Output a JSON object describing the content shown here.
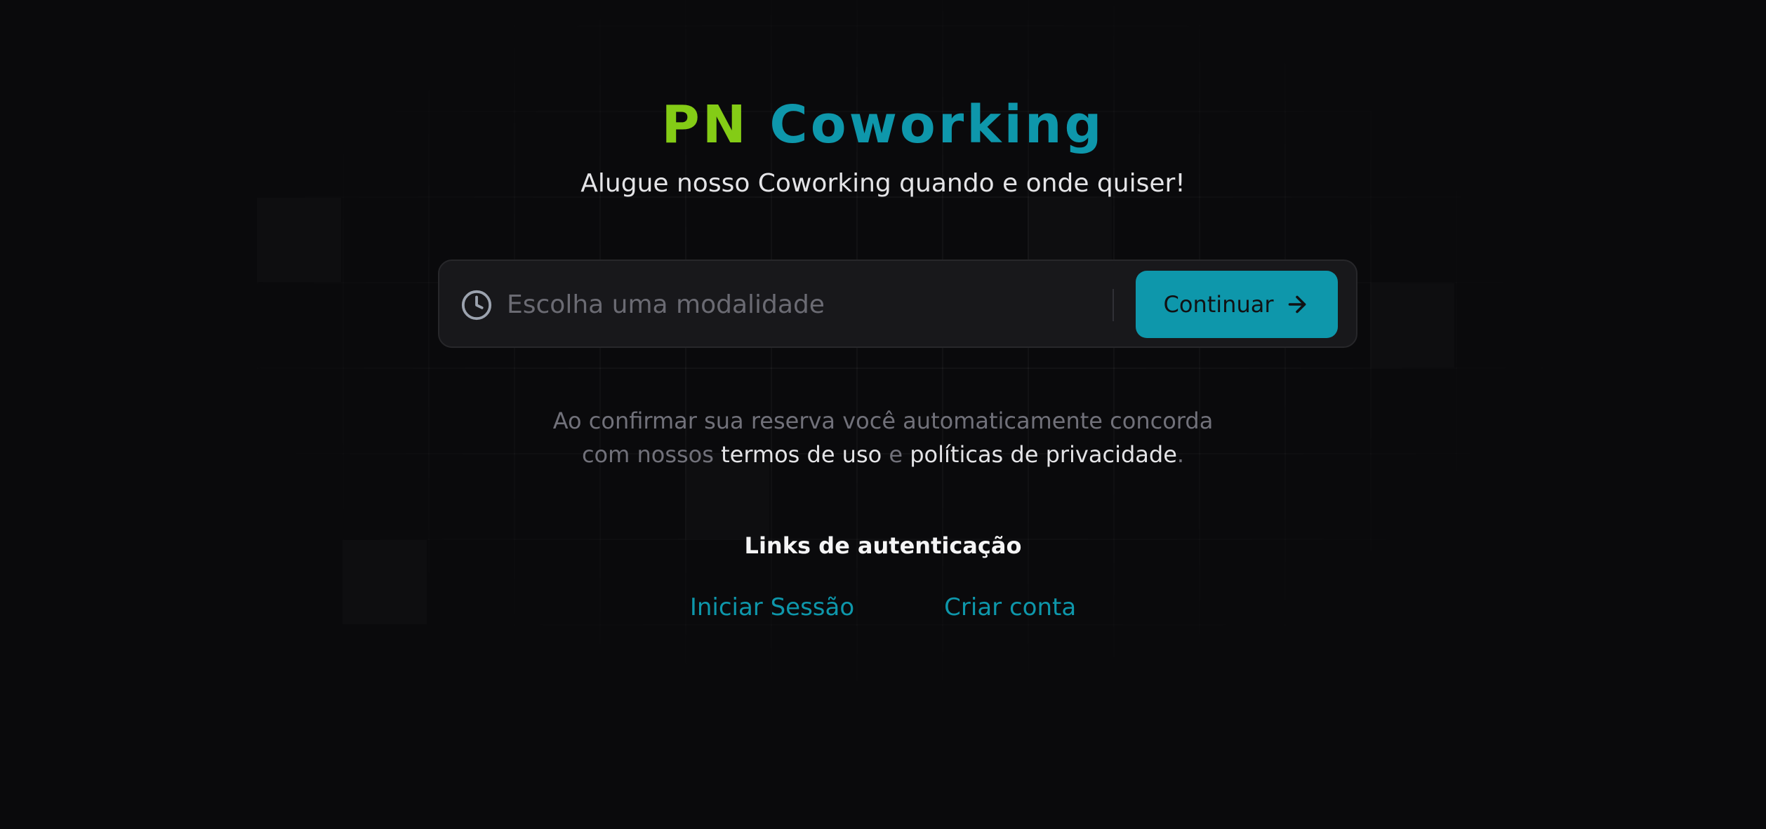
{
  "brand": {
    "title_part1": "PN",
    "title_part2": "Coworking",
    "title_part1_color": "#84cc16",
    "title_part2_color": "#0e97ab"
  },
  "hero": {
    "subtitle": "Alugue nosso Coworking quando e onde quiser!"
  },
  "search": {
    "icon": "clock-icon",
    "placeholder": "Escolha uma modalidade",
    "value": "",
    "button_label": "Continuar",
    "button_icon": "arrow-right-icon",
    "accent_color": "#0e97ab"
  },
  "terms": {
    "line1": "Ao confirmar sua reserva você automaticamente concorda",
    "prefix": "com nossos",
    "terms_link": "termos de uso",
    "conjunction": "e",
    "privacy_link": "políticas de privacidade",
    "suffix": "."
  },
  "auth": {
    "heading": "Links de autenticação",
    "login_label": "Iniciar Sessão",
    "signup_label": "Criar conta"
  }
}
